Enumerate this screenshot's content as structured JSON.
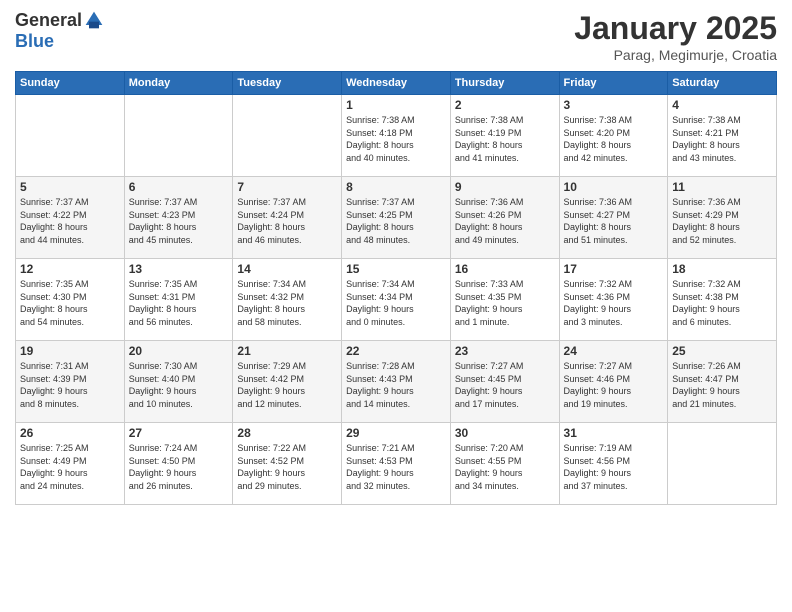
{
  "logo": {
    "general": "General",
    "blue": "Blue"
  },
  "title": "January 2025",
  "subtitle": "Parag, Megimurje, Croatia",
  "days_header": [
    "Sunday",
    "Monday",
    "Tuesday",
    "Wednesday",
    "Thursday",
    "Friday",
    "Saturday"
  ],
  "weeks": [
    [
      {
        "day": "",
        "info": ""
      },
      {
        "day": "",
        "info": ""
      },
      {
        "day": "",
        "info": ""
      },
      {
        "day": "1",
        "info": "Sunrise: 7:38 AM\nSunset: 4:18 PM\nDaylight: 8 hours\nand 40 minutes."
      },
      {
        "day": "2",
        "info": "Sunrise: 7:38 AM\nSunset: 4:19 PM\nDaylight: 8 hours\nand 41 minutes."
      },
      {
        "day": "3",
        "info": "Sunrise: 7:38 AM\nSunset: 4:20 PM\nDaylight: 8 hours\nand 42 minutes."
      },
      {
        "day": "4",
        "info": "Sunrise: 7:38 AM\nSunset: 4:21 PM\nDaylight: 8 hours\nand 43 minutes."
      }
    ],
    [
      {
        "day": "5",
        "info": "Sunrise: 7:37 AM\nSunset: 4:22 PM\nDaylight: 8 hours\nand 44 minutes."
      },
      {
        "day": "6",
        "info": "Sunrise: 7:37 AM\nSunset: 4:23 PM\nDaylight: 8 hours\nand 45 minutes."
      },
      {
        "day": "7",
        "info": "Sunrise: 7:37 AM\nSunset: 4:24 PM\nDaylight: 8 hours\nand 46 minutes."
      },
      {
        "day": "8",
        "info": "Sunrise: 7:37 AM\nSunset: 4:25 PM\nDaylight: 8 hours\nand 48 minutes."
      },
      {
        "day": "9",
        "info": "Sunrise: 7:36 AM\nSunset: 4:26 PM\nDaylight: 8 hours\nand 49 minutes."
      },
      {
        "day": "10",
        "info": "Sunrise: 7:36 AM\nSunset: 4:27 PM\nDaylight: 8 hours\nand 51 minutes."
      },
      {
        "day": "11",
        "info": "Sunrise: 7:36 AM\nSunset: 4:29 PM\nDaylight: 8 hours\nand 52 minutes."
      }
    ],
    [
      {
        "day": "12",
        "info": "Sunrise: 7:35 AM\nSunset: 4:30 PM\nDaylight: 8 hours\nand 54 minutes."
      },
      {
        "day": "13",
        "info": "Sunrise: 7:35 AM\nSunset: 4:31 PM\nDaylight: 8 hours\nand 56 minutes."
      },
      {
        "day": "14",
        "info": "Sunrise: 7:34 AM\nSunset: 4:32 PM\nDaylight: 8 hours\nand 58 minutes."
      },
      {
        "day": "15",
        "info": "Sunrise: 7:34 AM\nSunset: 4:34 PM\nDaylight: 9 hours\nand 0 minutes."
      },
      {
        "day": "16",
        "info": "Sunrise: 7:33 AM\nSunset: 4:35 PM\nDaylight: 9 hours\nand 1 minute."
      },
      {
        "day": "17",
        "info": "Sunrise: 7:32 AM\nSunset: 4:36 PM\nDaylight: 9 hours\nand 3 minutes."
      },
      {
        "day": "18",
        "info": "Sunrise: 7:32 AM\nSunset: 4:38 PM\nDaylight: 9 hours\nand 6 minutes."
      }
    ],
    [
      {
        "day": "19",
        "info": "Sunrise: 7:31 AM\nSunset: 4:39 PM\nDaylight: 9 hours\nand 8 minutes."
      },
      {
        "day": "20",
        "info": "Sunrise: 7:30 AM\nSunset: 4:40 PM\nDaylight: 9 hours\nand 10 minutes."
      },
      {
        "day": "21",
        "info": "Sunrise: 7:29 AM\nSunset: 4:42 PM\nDaylight: 9 hours\nand 12 minutes."
      },
      {
        "day": "22",
        "info": "Sunrise: 7:28 AM\nSunset: 4:43 PM\nDaylight: 9 hours\nand 14 minutes."
      },
      {
        "day": "23",
        "info": "Sunrise: 7:27 AM\nSunset: 4:45 PM\nDaylight: 9 hours\nand 17 minutes."
      },
      {
        "day": "24",
        "info": "Sunrise: 7:27 AM\nSunset: 4:46 PM\nDaylight: 9 hours\nand 19 minutes."
      },
      {
        "day": "25",
        "info": "Sunrise: 7:26 AM\nSunset: 4:47 PM\nDaylight: 9 hours\nand 21 minutes."
      }
    ],
    [
      {
        "day": "26",
        "info": "Sunrise: 7:25 AM\nSunset: 4:49 PM\nDaylight: 9 hours\nand 24 minutes."
      },
      {
        "day": "27",
        "info": "Sunrise: 7:24 AM\nSunset: 4:50 PM\nDaylight: 9 hours\nand 26 minutes."
      },
      {
        "day": "28",
        "info": "Sunrise: 7:22 AM\nSunset: 4:52 PM\nDaylight: 9 hours\nand 29 minutes."
      },
      {
        "day": "29",
        "info": "Sunrise: 7:21 AM\nSunset: 4:53 PM\nDaylight: 9 hours\nand 32 minutes."
      },
      {
        "day": "30",
        "info": "Sunrise: 7:20 AM\nSunset: 4:55 PM\nDaylight: 9 hours\nand 34 minutes."
      },
      {
        "day": "31",
        "info": "Sunrise: 7:19 AM\nSunset: 4:56 PM\nDaylight: 9 hours\nand 37 minutes."
      },
      {
        "day": "",
        "info": ""
      }
    ]
  ]
}
